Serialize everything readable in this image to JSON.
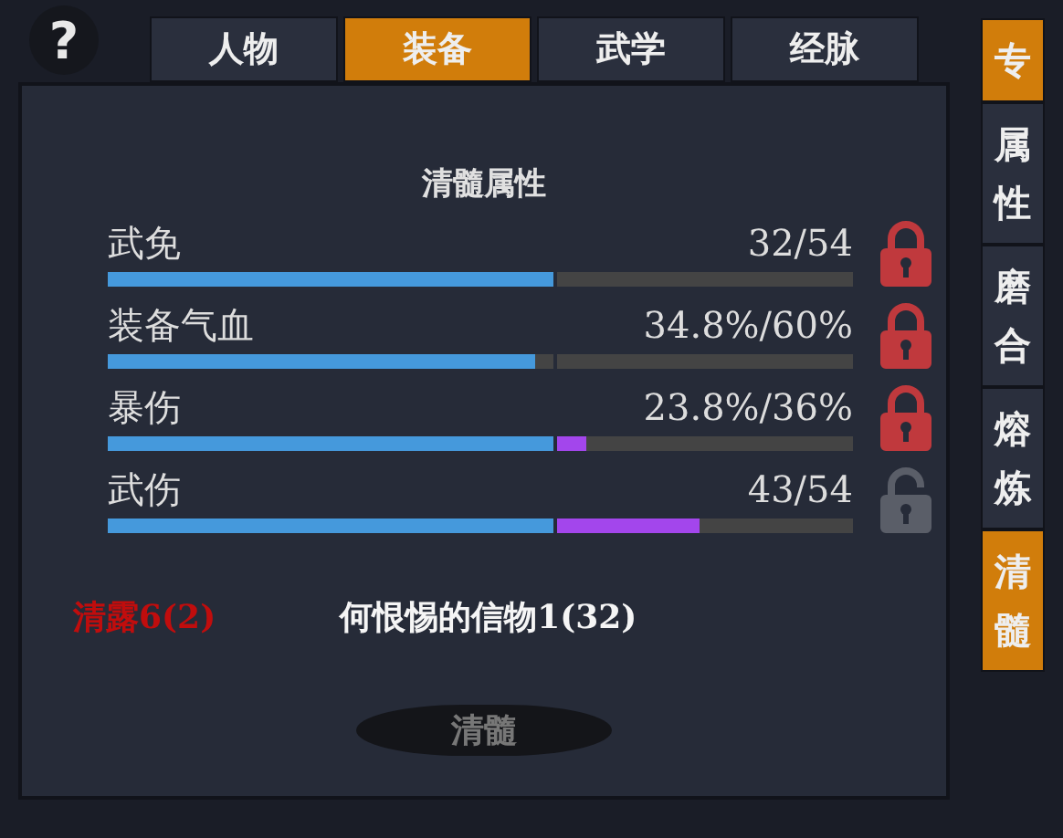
{
  "help_button": {
    "label": "?"
  },
  "tabs": [
    {
      "label": "人物",
      "selected": false
    },
    {
      "label": "装备",
      "selected": true
    },
    {
      "label": "武学",
      "selected": false
    },
    {
      "label": "经脉",
      "selected": false
    }
  ],
  "side_tabs": [
    {
      "label": "专",
      "selected": true
    },
    {
      "label": "属性",
      "selected": false
    },
    {
      "label": "磨合",
      "selected": false
    },
    {
      "label": "熔炼",
      "selected": false
    },
    {
      "label": "清髓",
      "selected": true
    }
  ],
  "panel": {
    "title": "清髓属性",
    "stats": [
      {
        "name": "武免",
        "reading": "32/54",
        "segments": [
          {
            "kind": "base",
            "level": 1
          }
        ],
        "locked": true
      },
      {
        "name": "装备气血",
        "reading": "34.8%/60%",
        "segments": [
          {
            "kind": "base",
            "level": 0.96
          }
        ],
        "locked": true
      },
      {
        "name": "暴伤",
        "reading": "23.8%/36%",
        "segments": [
          {
            "kind": "base",
            "level": 1
          },
          {
            "kind": "bonus",
            "level": 0.1
          }
        ],
        "locked": true
      },
      {
        "name": "武伤",
        "reading": "43/54",
        "segments": [
          {
            "kind": "base",
            "level": 1
          },
          {
            "kind": "bonus",
            "level": 0.48
          }
        ],
        "locked": false
      }
    ],
    "materials": [
      {
        "label": "清露6(2)",
        "enough": false
      },
      {
        "label": "何恨惕的信物1(32)",
        "enough": true
      }
    ],
    "action_button": {
      "label": "清髓",
      "disabled": true
    }
  }
}
